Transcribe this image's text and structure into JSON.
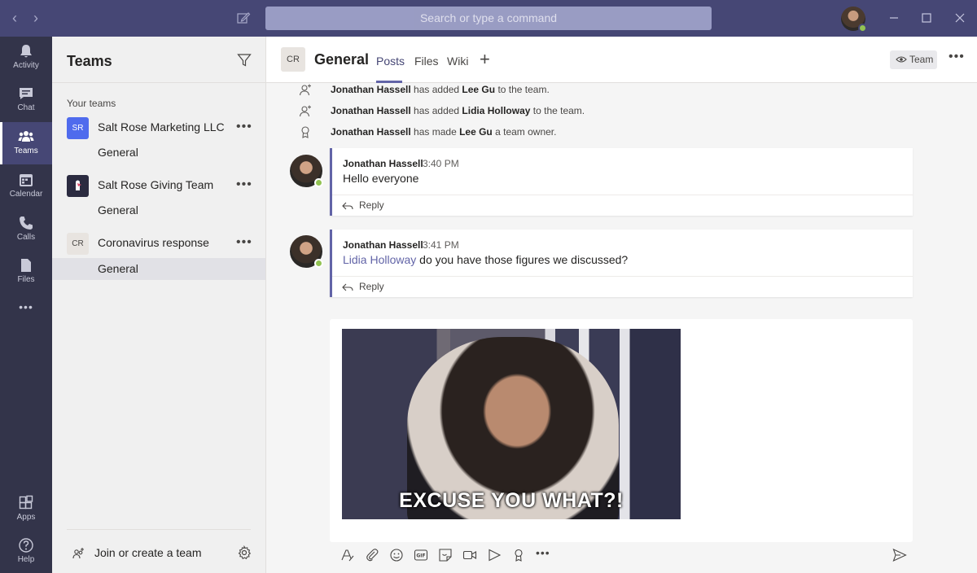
{
  "titlebar": {
    "search_placeholder": "Search or type a command"
  },
  "rail": {
    "items": [
      {
        "label": "Activity",
        "icon": "bell-icon"
      },
      {
        "label": "Chat",
        "icon": "chat-icon"
      },
      {
        "label": "Teams",
        "icon": "teams-icon"
      },
      {
        "label": "Calendar",
        "icon": "calendar-icon"
      },
      {
        "label": "Calls",
        "icon": "phone-icon"
      },
      {
        "label": "Files",
        "icon": "file-icon"
      },
      {
        "label": "Apps",
        "icon": "apps-icon"
      },
      {
        "label": "Help",
        "icon": "help-icon"
      }
    ],
    "more": "•••"
  },
  "teams_panel": {
    "title": "Teams",
    "section_label": "Your teams",
    "teams": [
      {
        "avatar": "SR",
        "name": "Salt Rose Marketing LLC",
        "channel": "General",
        "avatar_color": "#4f6bed"
      },
      {
        "avatar": "",
        "name": "Salt Rose Giving Team",
        "channel": "General",
        "avatar_color": "#2b2b40"
      },
      {
        "avatar": "CR",
        "name": "Coronavirus response",
        "channel": "General",
        "avatar_color": "#e8e4e0"
      }
    ],
    "more": "•••",
    "join_label": "Join or create a team"
  },
  "channel": {
    "avatar": "CR",
    "title": "General",
    "tabs": [
      "Posts",
      "Files",
      "Wiki"
    ],
    "add_tab": "+",
    "team_button": "Team",
    "more": "•••"
  },
  "system_messages": [
    {
      "actor": "Jonathan Hassell",
      "verb": " has added ",
      "target": "Lee Gu",
      "tail": " to the team.",
      "icon": "add-person-icon"
    },
    {
      "actor": "Jonathan Hassell",
      "verb": " has added ",
      "target": "Lidia Holloway",
      "tail": " to the team.",
      "icon": "add-person-icon"
    },
    {
      "actor": "Jonathan Hassell",
      "verb": " has made ",
      "target": "Lee Gu",
      "tail": " a team owner.",
      "icon": "award-icon"
    }
  ],
  "messages": [
    {
      "author": "Jonathan Hassell",
      "time": "3:40 PM",
      "mention": "",
      "text": "Hello everyone",
      "reply": "Reply"
    },
    {
      "author": "Jonathan Hassell",
      "time": "3:41 PM",
      "mention": "Lidia Holloway",
      "text": " do you have those figures we discussed?",
      "reply": "Reply"
    }
  ],
  "compose": {
    "gif_caption": "EXCUSE YOU WHAT?!",
    "more": "•••"
  },
  "colors": {
    "accent": "#6264a7",
    "titlebar": "#464775",
    "rail": "#33344a",
    "presence": "#92c353"
  }
}
